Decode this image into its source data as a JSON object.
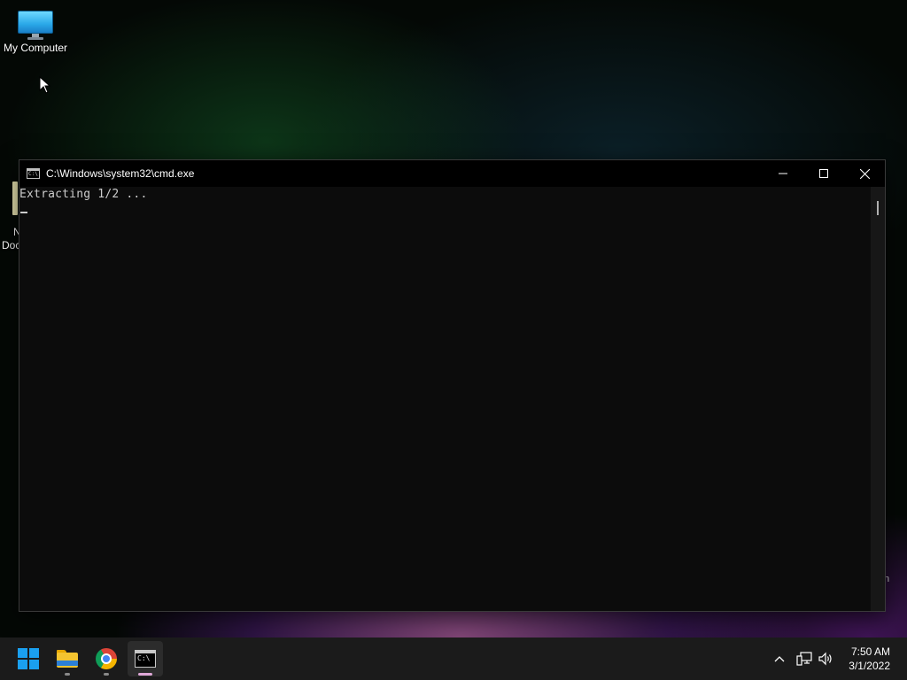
{
  "desktop": {
    "icons": [
      {
        "label": "My Computer",
        "icon": "computer-icon"
      }
    ],
    "partial_icon": {
      "label_line1": "N",
      "label_line2": "Doc",
      "icon": "notepad-document-icon"
    },
    "edge_text": "n"
  },
  "cmd_window": {
    "title": "C:\\Windows\\system32\\cmd.exe",
    "app_icon_glyph": "C:\\",
    "output_lines": [
      "Extracting 1/2 ..."
    ],
    "controls": {
      "minimize": "minimize-icon",
      "maximize": "maximize-icon",
      "close": "close-icon"
    },
    "colors": {
      "background": "#0c0c0c",
      "text": "#cccccc",
      "titlebar": "#000000"
    }
  },
  "taskbar": {
    "apps": [
      {
        "name": "Start",
        "icon": "windows-start-icon"
      },
      {
        "name": "File Explorer",
        "icon": "folder-icon"
      },
      {
        "name": "Google Chrome",
        "icon": "chrome-icon"
      },
      {
        "name": "Command Prompt",
        "icon": "cmd-icon",
        "active": true
      }
    ],
    "tray": {
      "icons": [
        "chevron-up-icon",
        "network-icon",
        "volume-icon"
      ]
    },
    "clock": {
      "time": "7:50 AM",
      "date": "3/1/2022"
    },
    "colors": {
      "background": "#1b1b1b",
      "active_indicator": "#e0a8d8",
      "start_accent": "#1aa0f0"
    }
  }
}
